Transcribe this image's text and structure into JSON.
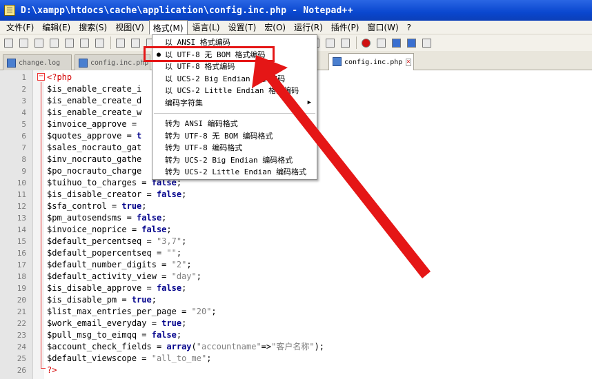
{
  "window": {
    "title": "D:\\xampp\\htdocs\\cache\\application\\config.inc.php - Notepad++"
  },
  "menubar": [
    {
      "label": "文件(F)"
    },
    {
      "label": "编辑(E)"
    },
    {
      "label": "搜索(S)"
    },
    {
      "label": "视图(V)"
    },
    {
      "label": "格式(M)"
    },
    {
      "label": "语言(L)"
    },
    {
      "label": "设置(T)"
    },
    {
      "label": "宏(O)"
    },
    {
      "label": "运行(R)"
    },
    {
      "label": "插件(P)"
    },
    {
      "label": "窗口(W)"
    },
    {
      "label": "?"
    }
  ],
  "active_menu": "格式(M)",
  "toolbar": {
    "icons": [
      "new-file-icon",
      "open-file-icon",
      "save-icon",
      "save-all-icon",
      "close-icon",
      "close-all-icon",
      "print-icon",
      "cut-icon",
      "copy-icon",
      "paste-icon",
      "undo-icon",
      "redo-icon",
      "find-icon",
      "replace-icon",
      "zoom-in-icon",
      "zoom-out-icon",
      "sync-v-icon",
      "sync-h-icon",
      "wrap-icon",
      "show-all-icon",
      "indent-guide-icon",
      "record-icon",
      "stop-icon",
      "play-icon",
      "play-multi-icon",
      "save-macro-icon"
    ]
  },
  "tabs": [
    {
      "label": "change.log"
    },
    {
      "label": "config.inc.php"
    },
    {
      "label": "config.inc.php"
    }
  ],
  "format_menu": {
    "items": [
      {
        "label": "以 ANSI 格式编码",
        "checked": false
      },
      {
        "label": "以 UTF-8 无 BOM 格式编码",
        "checked": true
      },
      {
        "label": "以 UTF-8 格式编码",
        "checked": false
      },
      {
        "label": "以 UCS-2 Big Endian 格式编码",
        "checked": false
      },
      {
        "label": "以 UCS-2 Little Endian 格式编码",
        "checked": false
      },
      {
        "label": "编码字符集",
        "checked": false,
        "submenu": true
      }
    ],
    "convert_items": [
      {
        "label": "转为 ANSI 编码格式"
      },
      {
        "label": "转为 UTF-8 无 BOM 编码格式"
      },
      {
        "label": "转为 UTF-8 编码格式"
      },
      {
        "label": "转为 UCS-2 Big Endian 编码格式"
      },
      {
        "label": "转为 UCS-2 Little Endian 编码格式"
      }
    ],
    "bullet": "●",
    "arrow": "▶"
  },
  "highlight_color": "#e51616",
  "editor": {
    "lines": [
      {
        "n": "1",
        "parts": [
          {
            "t": "<?php",
            "c": "tag"
          }
        ]
      },
      {
        "n": "2",
        "parts": [
          {
            "t": "$is_enable_create_i",
            "c": ""
          }
        ]
      },
      {
        "n": "3",
        "parts": [
          {
            "t": "$is_enable_create_d",
            "c": ""
          }
        ]
      },
      {
        "n": "4",
        "parts": [
          {
            "t": "$is_enable_create_w",
            "c": ""
          }
        ]
      },
      {
        "n": "5",
        "parts": [
          {
            "t": "$invoice_approve = ",
            "c": ""
          }
        ]
      },
      {
        "n": "6",
        "parts": [
          {
            "t": "$quotes_approve = ",
            "c": ""
          },
          {
            "t": "t",
            "c": "kw"
          }
        ]
      },
      {
        "n": "7",
        "parts": [
          {
            "t": "$sales_nocrauto_gat",
            "c": ""
          }
        ]
      },
      {
        "n": "8",
        "parts": [
          {
            "t": "$inv_nocrauto_gathe",
            "c": ""
          }
        ]
      },
      {
        "n": "9",
        "parts": [
          {
            "t": "$po_nocrauto_charge",
            "c": ""
          }
        ]
      },
      {
        "n": "10",
        "parts": [
          {
            "t": "$tuihuo_to_charges = ",
            "c": ""
          },
          {
            "t": "false",
            "c": "kw"
          },
          {
            "t": ";",
            "c": ""
          }
        ]
      },
      {
        "n": "11",
        "parts": [
          {
            "t": "$is_disable_creator = ",
            "c": ""
          },
          {
            "t": "false",
            "c": "kw"
          },
          {
            "t": ";",
            "c": ""
          }
        ]
      },
      {
        "n": "12",
        "parts": [
          {
            "t": "$sfa_control = ",
            "c": ""
          },
          {
            "t": "true",
            "c": "kw"
          },
          {
            "t": ";",
            "c": ""
          }
        ]
      },
      {
        "n": "13",
        "parts": [
          {
            "t": "$pm_autosendsms = ",
            "c": ""
          },
          {
            "t": "false",
            "c": "kw"
          },
          {
            "t": ";",
            "c": ""
          }
        ]
      },
      {
        "n": "14",
        "parts": [
          {
            "t": "$invoice_noprice = ",
            "c": ""
          },
          {
            "t": "false",
            "c": "kw"
          },
          {
            "t": ";",
            "c": ""
          }
        ]
      },
      {
        "n": "15",
        "parts": [
          {
            "t": "$default_percentseq = ",
            "c": ""
          },
          {
            "t": "\"3,7\"",
            "c": "str"
          },
          {
            "t": ";",
            "c": ""
          }
        ]
      },
      {
        "n": "16",
        "parts": [
          {
            "t": "$default_popercentseq = ",
            "c": ""
          },
          {
            "t": "\"\"",
            "c": "str"
          },
          {
            "t": ";",
            "c": ""
          }
        ]
      },
      {
        "n": "17",
        "parts": [
          {
            "t": "$default_number_digits = ",
            "c": ""
          },
          {
            "t": "\"2\"",
            "c": "str"
          },
          {
            "t": ";",
            "c": ""
          }
        ]
      },
      {
        "n": "18",
        "parts": [
          {
            "t": "$default_activity_view = ",
            "c": ""
          },
          {
            "t": "\"day\"",
            "c": "str"
          },
          {
            "t": ";",
            "c": ""
          }
        ]
      },
      {
        "n": "19",
        "parts": [
          {
            "t": "$is_disable_approve = ",
            "c": ""
          },
          {
            "t": "false",
            "c": "kw"
          },
          {
            "t": ";",
            "c": ""
          }
        ]
      },
      {
        "n": "20",
        "parts": [
          {
            "t": "$is_disable_pm = ",
            "c": ""
          },
          {
            "t": "true",
            "c": "kw"
          },
          {
            "t": ";",
            "c": ""
          }
        ]
      },
      {
        "n": "21",
        "parts": [
          {
            "t": "$list_max_entries_per_page = ",
            "c": ""
          },
          {
            "t": "\"20\"",
            "c": "str"
          },
          {
            "t": ";",
            "c": ""
          }
        ]
      },
      {
        "n": "22",
        "parts": [
          {
            "t": "$work_email_everyday = ",
            "c": ""
          },
          {
            "t": "true",
            "c": "kw"
          },
          {
            "t": ";",
            "c": ""
          }
        ]
      },
      {
        "n": "23",
        "parts": [
          {
            "t": "$pull_msg_to_eimqq = ",
            "c": ""
          },
          {
            "t": "false",
            "c": "kw"
          },
          {
            "t": ";",
            "c": ""
          }
        ]
      },
      {
        "n": "24",
        "parts": [
          {
            "t": "$account_check_fields = ",
            "c": ""
          },
          {
            "t": "array",
            "c": "kw"
          },
          {
            "t": "(",
            "c": ""
          },
          {
            "t": "\"accountname\"",
            "c": "str"
          },
          {
            "t": "=>",
            "c": ""
          },
          {
            "t": "\"客户名称\"",
            "c": "str"
          },
          {
            "t": ");",
            "c": ""
          }
        ]
      },
      {
        "n": "25",
        "parts": [
          {
            "t": "$default_viewscope = ",
            "c": ""
          },
          {
            "t": "\"all_to_me\"",
            "c": "str"
          },
          {
            "t": ";",
            "c": ""
          }
        ]
      },
      {
        "n": "26",
        "parts": [
          {
            "t": "?>",
            "c": "tag"
          }
        ]
      }
    ],
    "fold_toggle": "−"
  }
}
